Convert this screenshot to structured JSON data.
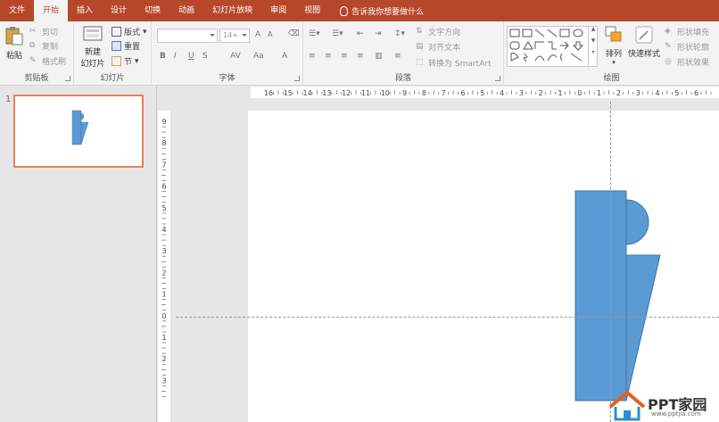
{
  "tabs": [
    "文件",
    "开始",
    "插入",
    "设计",
    "切换",
    "动画",
    "幻灯片放映",
    "审阅",
    "视图"
  ],
  "tell_me": "告诉我你想要做什么",
  "clipboard": {
    "paste": "粘贴",
    "cut": "剪切",
    "copy": "复制",
    "format_painter": "格式刷",
    "title": "剪贴板"
  },
  "slides_group": {
    "new_slide_line1": "新建",
    "new_slide_line2": "幻灯片",
    "layout": "版式",
    "reset": "重置",
    "section": "节",
    "title": "幻灯片"
  },
  "font_group": {
    "size_value": "14+",
    "title": "字体",
    "bold": "B",
    "italic": "I",
    "underline": "U",
    "shadow": "S",
    "spacing": "AV",
    "case": "Aa",
    "color": "A",
    "grow": "A",
    "shrink": "A"
  },
  "paragraph_group": {
    "text_direction": "文字方向",
    "align_text": "对齐文本",
    "smartart": "转换为 SmartArt",
    "title": "段落"
  },
  "drawing_group": {
    "arrange": "排列",
    "quick_styles": "快速样式",
    "fill": "形状填充",
    "outline": "形状轮廓",
    "effects": "形状效果",
    "title": "绘图"
  },
  "thumbnail": {
    "number": "1"
  },
  "ruler": {
    "h_labels": [
      "16",
      "15",
      "14",
      "13",
      "12",
      "11",
      "10",
      "9",
      "8",
      "7",
      "6",
      "5",
      "4",
      "3",
      "2",
      "1",
      "0",
      "1",
      "2",
      "3",
      "4",
      "5",
      "6"
    ],
    "v_labels": [
      "9",
      "8",
      "7",
      "6",
      "5",
      "4",
      "3",
      "2",
      "1",
      "0",
      "1",
      "2",
      "3"
    ]
  },
  "watermark": {
    "brand": "PPT家园",
    "url": "www.pptjia.com"
  },
  "colors": {
    "accent": "#b7472a",
    "shape_fill": "#5b9bd5",
    "shape_stroke": "#41719c",
    "selection": "#e8805c"
  }
}
